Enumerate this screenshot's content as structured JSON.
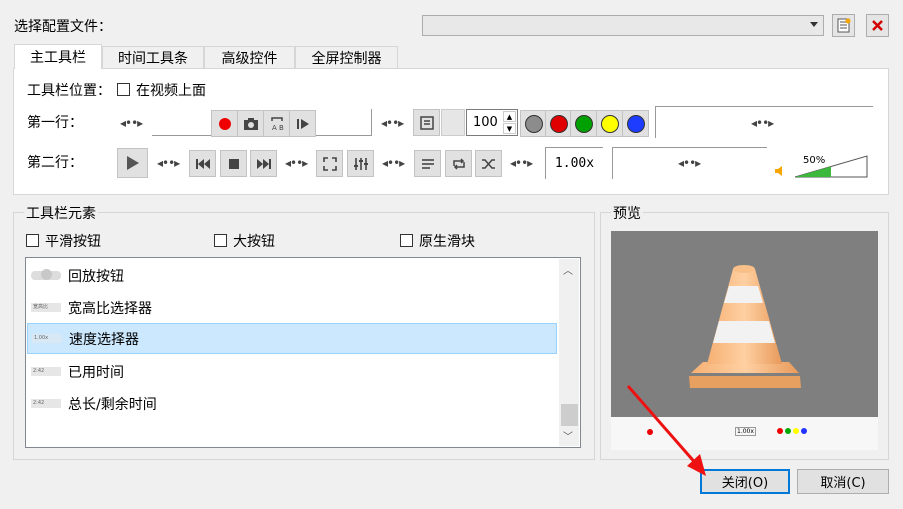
{
  "profile": {
    "label": "选择配置文件：",
    "selected": ""
  },
  "tabs": [
    "主工具栏",
    "时间工具条",
    "高级控件",
    "全屏控制器"
  ],
  "main_toolbar": {
    "position_label": "工具栏位置：",
    "above_video_label": "在视频上面",
    "row1_label": "第一行：",
    "row2_label": "第二行：",
    "spin_value": "100",
    "speed_label": "1.00x",
    "volume_percent": "50%",
    "volume_level": 0.5,
    "colors": [
      "#8c8c8c",
      "#e00000",
      "#00a000",
      "#ffff00",
      "#1e3cff"
    ]
  },
  "elements_group": {
    "title": "工具栏元素",
    "options": [
      "平滑按钮",
      "大按钮",
      "原生滑块"
    ],
    "items": [
      {
        "label": "回放按钮",
        "thumb": ""
      },
      {
        "label": "宽高比选择器",
        "thumb": "宽高比"
      },
      {
        "label": "速度选择器",
        "thumb": "1.00x"
      },
      {
        "label": "已用时间",
        "thumb": "2:42"
      },
      {
        "label": "总长/剩余时间",
        "thumb": "2:42"
      }
    ]
  },
  "preview": {
    "title": "预览",
    "mini_speed": "1.00x"
  },
  "buttons": {
    "close": "关闭(O)",
    "cancel": "取消(C)"
  }
}
